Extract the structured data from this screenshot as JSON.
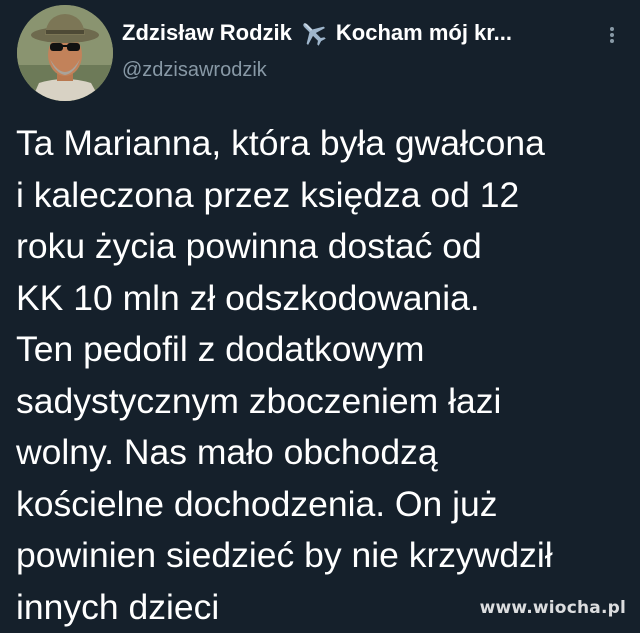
{
  "tweet": {
    "author_name": "Zdzisław Rodzik",
    "author_bio_snippet": "Kocham mój kr...",
    "handle": "@zdzisawrodzik",
    "body_lines": [
      "Ta Marianna, która była gwałcona",
      "i kaleczona przez księdza od 12",
      "roku życia powinna dostać od",
      "KK 10 mln zł odszkodowania.",
      "Ten pedofil z dodatkowym",
      "sadystycznym zboczeniem łazi",
      "wolny. Nas mało obchodzą",
      "kościelne dochodzenia. On już",
      "powinien siedzieć by nie krzywdził",
      "innych dzieci"
    ]
  },
  "icons": {
    "name_emoji": "airplane-icon",
    "menu": "more-options-icon"
  },
  "watermark": "www.wiocha.pl",
  "colors": {
    "background": "#15202b",
    "primary_text": "#ffffff",
    "secondary_text": "#8899a6"
  }
}
